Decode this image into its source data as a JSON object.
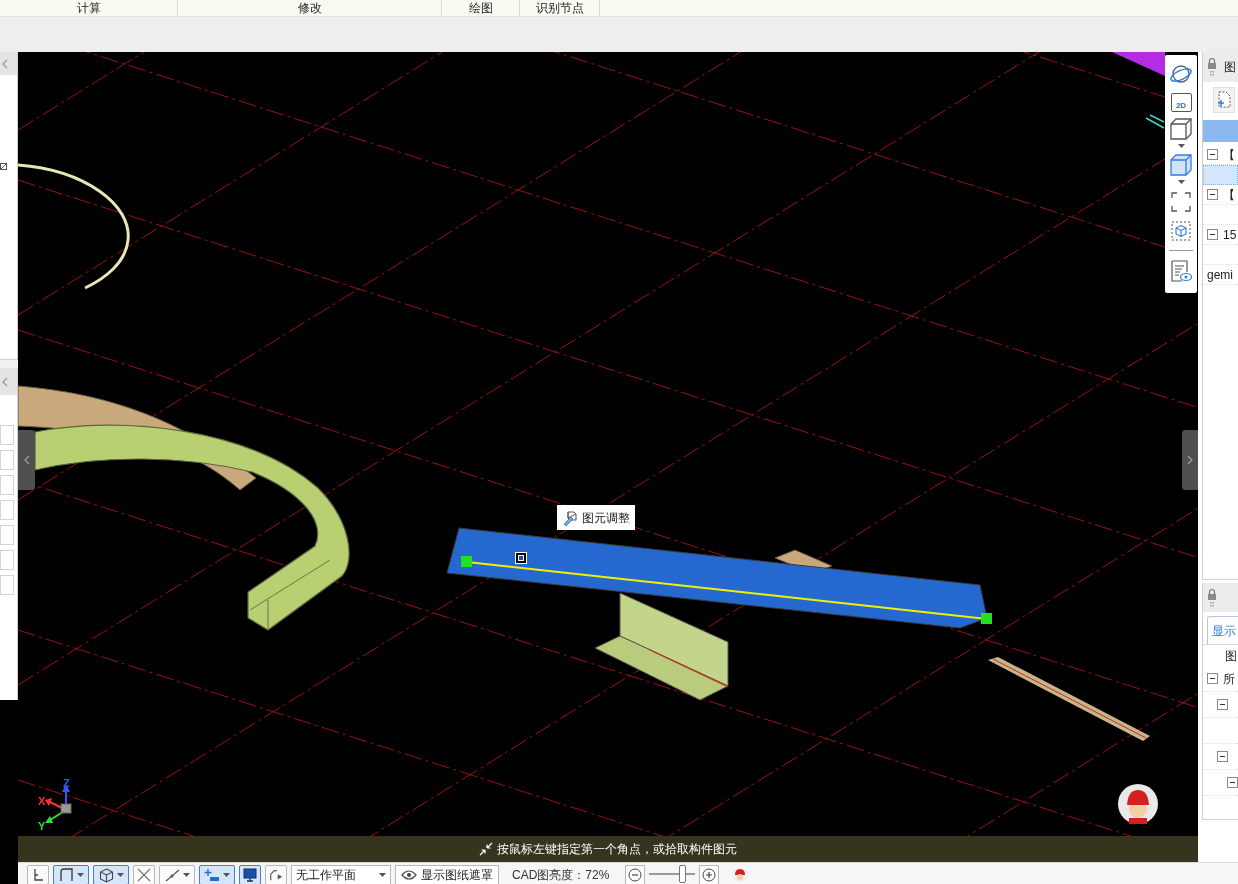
{
  "ribbon_groups": [
    {
      "label": "计算"
    },
    {
      "label": "修改"
    },
    {
      "label": "绘图"
    },
    {
      "label": "识别节点"
    }
  ],
  "viewport": {
    "tooltip": {
      "label": "图元调整"
    },
    "status": "按鼠标左键指定第一个角点，或拾取构件图元",
    "axes": [
      {
        "kind": "z",
        "label": "Z"
      },
      {
        "kind": "x",
        "label": "X"
      },
      {
        "kind": "y",
        "label": "Y"
      }
    ]
  },
  "view_tools": [
    {
      "kind": "orbit"
    },
    {
      "kind": "label",
      "label": "2D"
    },
    {
      "kind": "cube",
      "selected": false,
      "dropdown": true
    },
    {
      "kind": "cube",
      "selected": true,
      "dropdown": true
    },
    {
      "kind": "frame"
    },
    {
      "kind": "frame-cube"
    },
    {
      "kind": "divider"
    },
    {
      "kind": "doc-eye"
    }
  ],
  "right_panel": {
    "title": "图",
    "tree": [
      {
        "label": "【",
        "expanded": true,
        "selected": false,
        "children": [
          {
            "selected": true
          }
        ]
      },
      {
        "label": "【",
        "expanded": true,
        "selected": false,
        "children": [
          {
            "selected": false
          }
        ]
      },
      {
        "label": "15",
        "expanded": true,
        "selected": false,
        "children": [
          {
            "selected": false
          }
        ]
      },
      {
        "label": "gemi",
        "selected": false
      }
    ]
  },
  "lower_panel": {
    "tabs": [
      {
        "label": "显示",
        "selected": true
      }
    ],
    "heading": "图",
    "tree": [
      {
        "label": "所",
        "expanded": true,
        "selected": false,
        "children": [
          {
            "expanded": true,
            "selected": false,
            "children": [
              {
                "selected": false
              }
            ]
          },
          {
            "expanded": true,
            "selected": false,
            "children": [
              {
                "expanded": true,
                "selected": false
              }
            ]
          }
        ]
      }
    ]
  },
  "bottom_toolbar": {
    "tools": [
      {
        "kind": "corner",
        "selected": false,
        "dropdown": false
      },
      {
        "kind": "rect",
        "selected": true,
        "dropdown": true
      },
      {
        "kind": "cube",
        "selected": true,
        "dropdown": true
      },
      {
        "kind": "cross",
        "selected": false,
        "dropdown": false
      },
      {
        "kind": "line",
        "selected": false,
        "dropdown": true
      },
      {
        "kind": "axis",
        "selected": true,
        "dropdown": true
      },
      {
        "kind": "screen",
        "selected": true,
        "dropdown": false
      },
      {
        "kind": "arc",
        "selected": false,
        "dropdown": false
      }
    ],
    "plane_select": {
      "value": "无工作平面"
    },
    "mask_button": "显示图纸遮罩",
    "brightness": {
      "label": "CAD图亮度：72%",
      "level": 0.72
    }
  }
}
